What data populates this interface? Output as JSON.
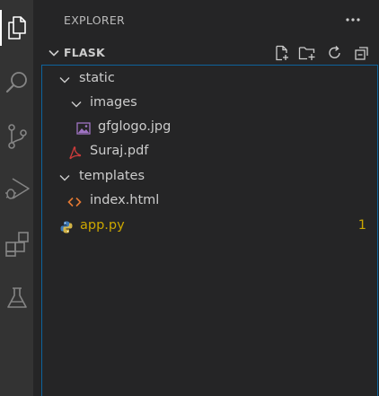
{
  "activity_bar": {
    "items": [
      {
        "name": "explorer",
        "icon": "files-icon",
        "active": true
      },
      {
        "name": "search",
        "icon": "search-icon",
        "active": false
      },
      {
        "name": "source-control",
        "icon": "source-control-icon",
        "active": false
      },
      {
        "name": "run-debug",
        "icon": "run-debug-icon",
        "active": false
      },
      {
        "name": "extensions",
        "icon": "extensions-icon",
        "active": false
      },
      {
        "name": "testing",
        "icon": "beaker-icon",
        "active": false
      }
    ]
  },
  "sidebar": {
    "title": "EXPLORER",
    "more_actions": "···"
  },
  "section": {
    "title": "FLASK",
    "expanded": true,
    "actions": [
      "new-file-icon",
      "new-folder-icon",
      "refresh-icon",
      "collapse-all-icon"
    ]
  },
  "tree": [
    {
      "label": "static",
      "type": "folder",
      "expanded": true,
      "depth": 0
    },
    {
      "label": "images",
      "type": "folder",
      "expanded": true,
      "depth": 1
    },
    {
      "label": "gfglogo.jpg",
      "type": "image",
      "depth": 2
    },
    {
      "label": "Suraj.pdf",
      "type": "pdf",
      "depth": 1
    },
    {
      "label": "templates",
      "type": "folder",
      "expanded": true,
      "depth": 0
    },
    {
      "label": "index.html",
      "type": "html",
      "depth": 1
    },
    {
      "label": "app.py",
      "type": "python",
      "depth": 0,
      "modified": true,
      "badge": "1"
    }
  ],
  "colors": {
    "activity_bar_bg": "#333333",
    "sidebar_bg": "#252526",
    "focus_border": "#0e639c",
    "modified_text": "#cca700"
  }
}
